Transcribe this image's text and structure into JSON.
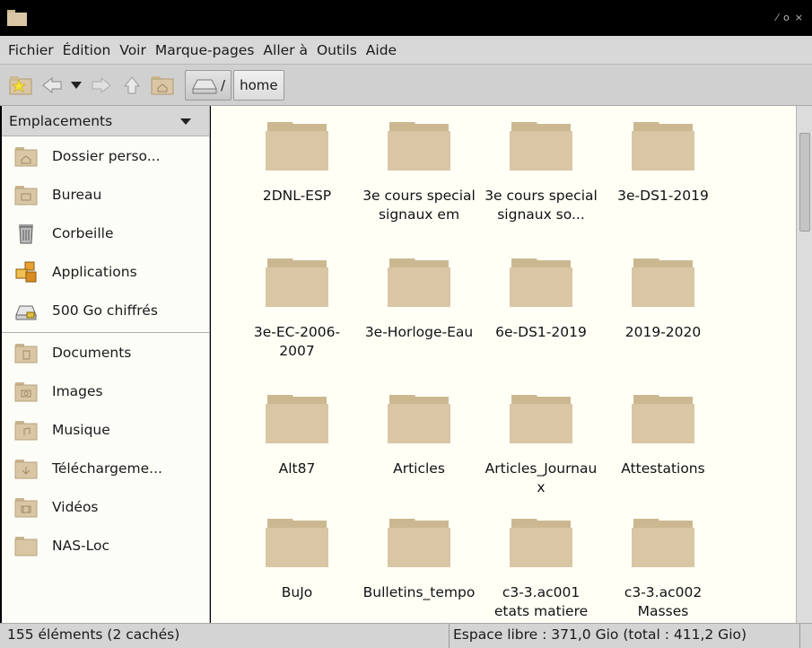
{
  "window": {
    "controls": [
      "⁄",
      "o",
      "×"
    ]
  },
  "menubar": [
    {
      "label": "Fichier"
    },
    {
      "label": "Édition"
    },
    {
      "label": "Voir"
    },
    {
      "label": "Marque-pages"
    },
    {
      "label": "Aller à"
    },
    {
      "label": "Outils"
    },
    {
      "label": "Aide"
    }
  ],
  "toolbar": {
    "path_root": "/",
    "path_current": "home"
  },
  "sidebar": {
    "header": "Emplacements",
    "places": [
      {
        "label": "Dossier perso...",
        "icon": "home-folder-icon"
      },
      {
        "label": "Bureau",
        "icon": "desktop-folder-icon"
      },
      {
        "label": "Corbeille",
        "icon": "trash-icon"
      },
      {
        "label": "Applications",
        "icon": "applications-icon"
      },
      {
        "label": "500 Go chiffrés",
        "icon": "drive-icon"
      }
    ],
    "bookmarks": [
      {
        "label": "Documents",
        "icon": "documents-folder-icon"
      },
      {
        "label": "Images",
        "icon": "pictures-folder-icon"
      },
      {
        "label": "Musique",
        "icon": "music-folder-icon"
      },
      {
        "label": "Téléchargeme...",
        "icon": "downloads-folder-icon"
      },
      {
        "label": "Vidéos",
        "icon": "videos-folder-icon"
      },
      {
        "label": "NAS-Loc",
        "icon": "folder-icon"
      }
    ]
  },
  "files": [
    {
      "name": "2DNL-ESP"
    },
    {
      "name": "3e cours special signaux em"
    },
    {
      "name": "3e cours special signaux so..."
    },
    {
      "name": "3e-DS1-2019"
    },
    {
      "name": "3e-EC-2006-2007"
    },
    {
      "name": "3e-Horloge-Eau"
    },
    {
      "name": "6e-DS1-2019"
    },
    {
      "name": "2019-2020"
    },
    {
      "name": "Alt87"
    },
    {
      "name": "Articles"
    },
    {
      "name": "Articles_Journaux"
    },
    {
      "name": "Attestations"
    },
    {
      "name": "BuJo"
    },
    {
      "name": "Bulletins_tempo"
    },
    {
      "name": "c3-3.ac001 etats matiere"
    },
    {
      "name": "c3-3.ac002 Masses"
    }
  ],
  "status": {
    "items": "155 éléments (2 cachés)",
    "space": "Espace libre : 371,0 Gio (total : 411,2 Gio)"
  },
  "colors": {
    "folder": "#d9c6a5",
    "file_background": "#fffff6"
  }
}
